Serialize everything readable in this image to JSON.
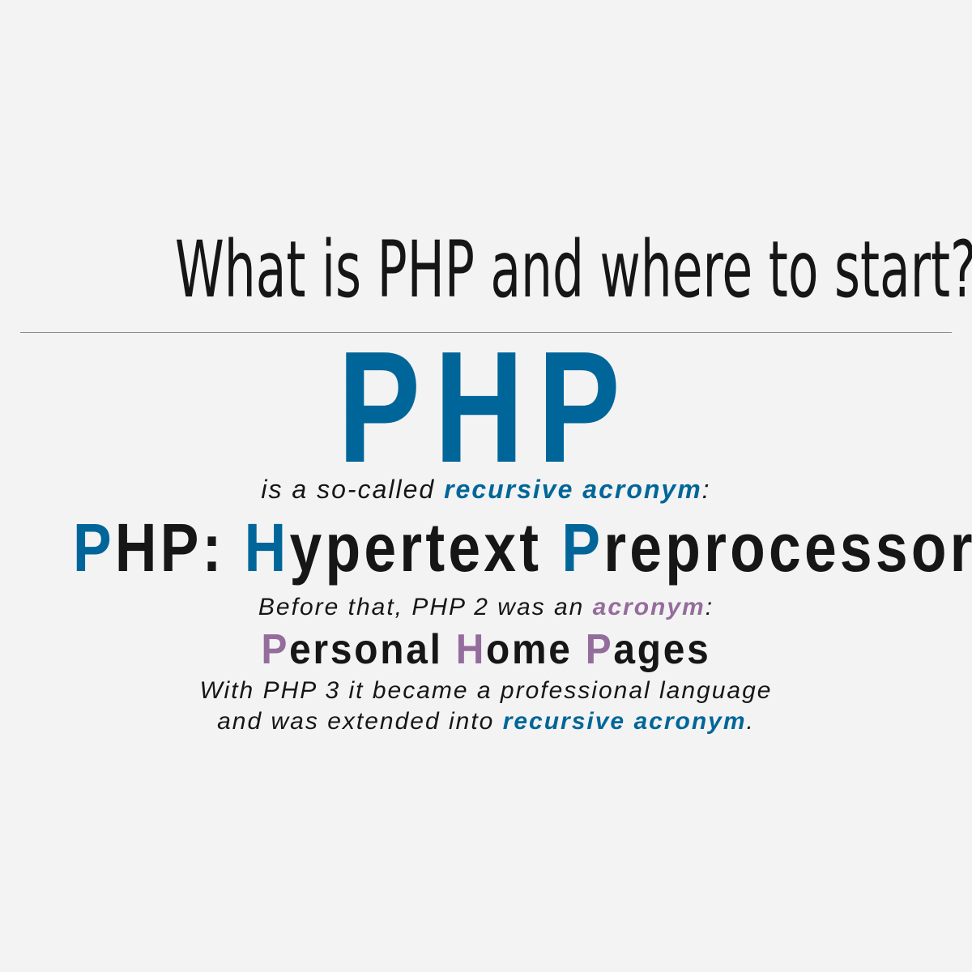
{
  "title": "What is PHP and where to start?",
  "big_php": "PHP",
  "intro": {
    "prefix": "is a so-called ",
    "highlight": "recursive acronym",
    "suffix": ":"
  },
  "expansion": {
    "p1_initial": "P",
    "p1_rest": "HP: ",
    "h_initial": "H",
    "h_rest": "ypertext ",
    "p2_initial": "P",
    "p2_rest": "reprocessor"
  },
  "history": {
    "prefix": "Before that, PHP 2 was an ",
    "highlight": "acronym",
    "suffix": ":"
  },
  "old_name": {
    "p_initial": "P",
    "p_rest": "ersonal ",
    "h_initial": "H",
    "h_rest": "ome ",
    "p2_initial": "P",
    "p2_rest": "ages"
  },
  "closing": {
    "line1": "With PHP 3 it became a professional language",
    "line2_prefix": "and was extended into ",
    "line2_highlight": "recursive acronym",
    "line2_suffix": "."
  },
  "colors": {
    "background": "#f3f3f3",
    "text": "#161616",
    "accent_blue": "#006699",
    "accent_purple": "#946d9c"
  }
}
